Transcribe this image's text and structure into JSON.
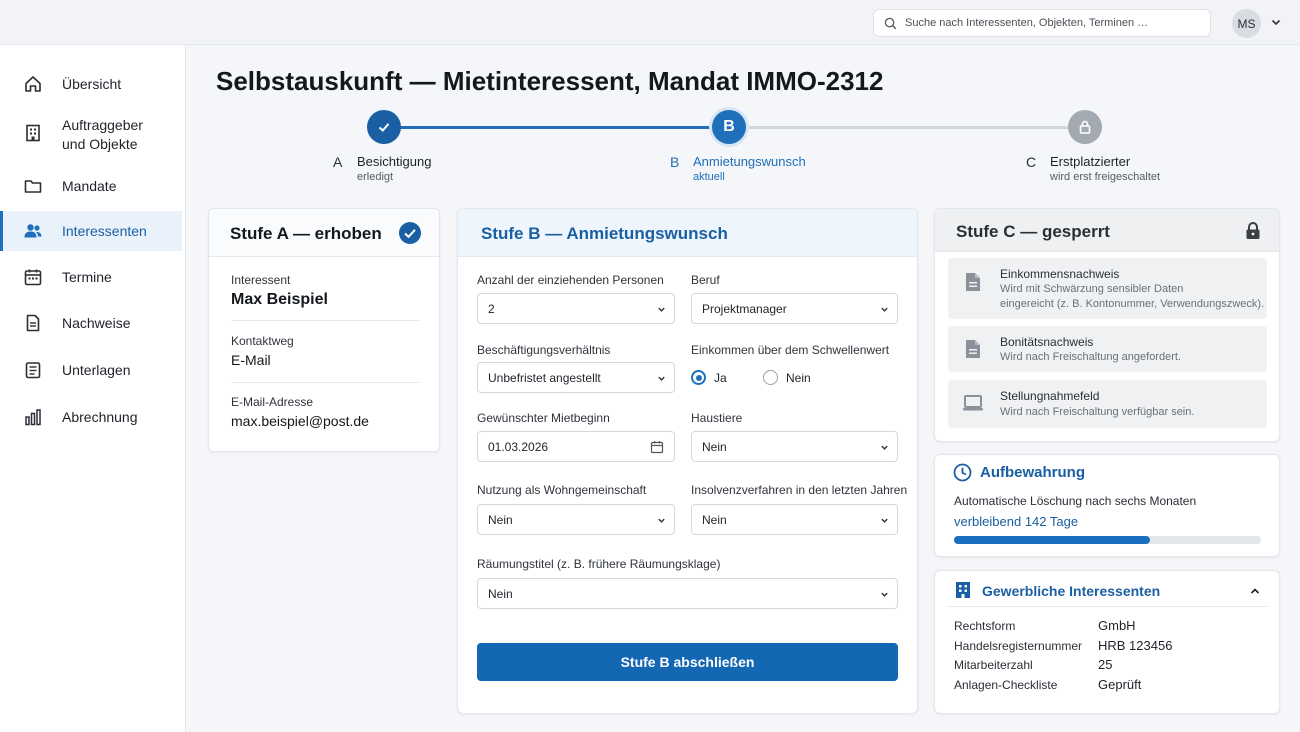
{
  "topbar": {
    "search_placeholder": "Suche nach Interessenten, Objekten, Terminen …",
    "avatar_initials": "MS"
  },
  "sidebar": {
    "items": [
      {
        "label": "Übersicht",
        "icon": "home-icon"
      },
      {
        "label": "Auftraggeber\nund Objekte",
        "icon": "building-icon"
      },
      {
        "label": "Mandate",
        "icon": "folder-icon"
      },
      {
        "label": "Interessenten",
        "icon": "users-icon",
        "active": true
      },
      {
        "label": "Termine",
        "icon": "calendar-icon"
      },
      {
        "label": "Nachweise",
        "icon": "document-icon"
      },
      {
        "label": "Unterlagen",
        "icon": "files-icon"
      },
      {
        "label": "Abrechnung",
        "icon": "bar-chart-icon"
      }
    ]
  },
  "page": {
    "title": "Selbstauskunft — Mietinteressent, Mandat IMMO-2312"
  },
  "stepper": {
    "steps": [
      {
        "letter": "A",
        "name": "Besichtigung",
        "status": "erledigt",
        "state": "done"
      },
      {
        "letter": "B",
        "name": "Anmietungswunsch",
        "status": "aktuell",
        "state": "current"
      },
      {
        "letter": "C",
        "name": "Erstplatzierter",
        "status": "wird erst freigeschaltet",
        "state": "locked"
      }
    ]
  },
  "stage_a": {
    "title": "Stufe A — erhoben",
    "fields": [
      {
        "label": "Interessent",
        "value": "Max Beispiel"
      },
      {
        "label": "Kontaktweg",
        "value": "E-Mail"
      },
      {
        "label": "E-Mail-Adresse",
        "value": "max.beispiel@post.de"
      }
    ]
  },
  "stage_b": {
    "title": "Stufe B — Anmietungswunsch",
    "persons": {
      "label": "Anzahl der einziehenden Personen",
      "value": "2"
    },
    "job": {
      "label": "Beruf",
      "value": "Projektmanager"
    },
    "employment": {
      "label": "Beschäftigungsverhältnis",
      "value": "Unbefristet angestellt"
    },
    "income": {
      "label": "Einkommen über dem Schwellenwert",
      "options": [
        "Ja",
        "Nein"
      ],
      "selected": "Ja"
    },
    "start": {
      "label": "Gewünschter Mietbeginn",
      "value": "01.03.2026"
    },
    "pets": {
      "label": "Haustiere",
      "value": "Nein"
    },
    "shared": {
      "label": "Nutzung als Wohngemeinschaft",
      "value": "Nein"
    },
    "insolvency": {
      "label": "Insolvenzverfahren in den letzten Jahren",
      "value": "Nein"
    },
    "eviction": {
      "label": "Räumungstitel (z. B. frühere Räumungsklage)",
      "value": "Nein"
    },
    "submit_label": "Stufe B abschließen"
  },
  "stage_c": {
    "title": "Stufe C — gesperrt",
    "items": [
      {
        "title": "Einkommensnachweis",
        "desc1": "Wird mit Schwärzung sensibler Daten",
        "desc2": "eingereicht (z. B. Kontonummer, Verwendungszweck).",
        "icon": "document-icon"
      },
      {
        "title": "Bonitätsnachweis",
        "desc1": "Wird nach Freischaltung angefordert.",
        "icon": "document-icon"
      },
      {
        "title": "Stellungnahmefeld",
        "desc1": "Wird nach Freischaltung verfügbar sein.",
        "icon": "laptop-icon"
      }
    ]
  },
  "retention": {
    "title": "Aufbewahrung",
    "text": "Automatische Löschung nach sechs Monaten",
    "remaining": "verbleibend 142 Tage",
    "progress": 0.64
  },
  "commercial": {
    "title": "Gewerbliche Interessenten",
    "rows": [
      {
        "label": "Rechtsform",
        "value": "GmbH"
      },
      {
        "label": "Handelsregisternummer",
        "value": "HRB 123456"
      },
      {
        "label": "Mitarbeiterzahl",
        "value": "25"
      },
      {
        "label": "Anlagen-Checkliste",
        "value": "Geprüft"
      }
    ]
  },
  "colors": {
    "accent": "#1f6fba",
    "button": "#1467b3",
    "done": "#1a5fa3",
    "locked": "#9aa1aa"
  }
}
